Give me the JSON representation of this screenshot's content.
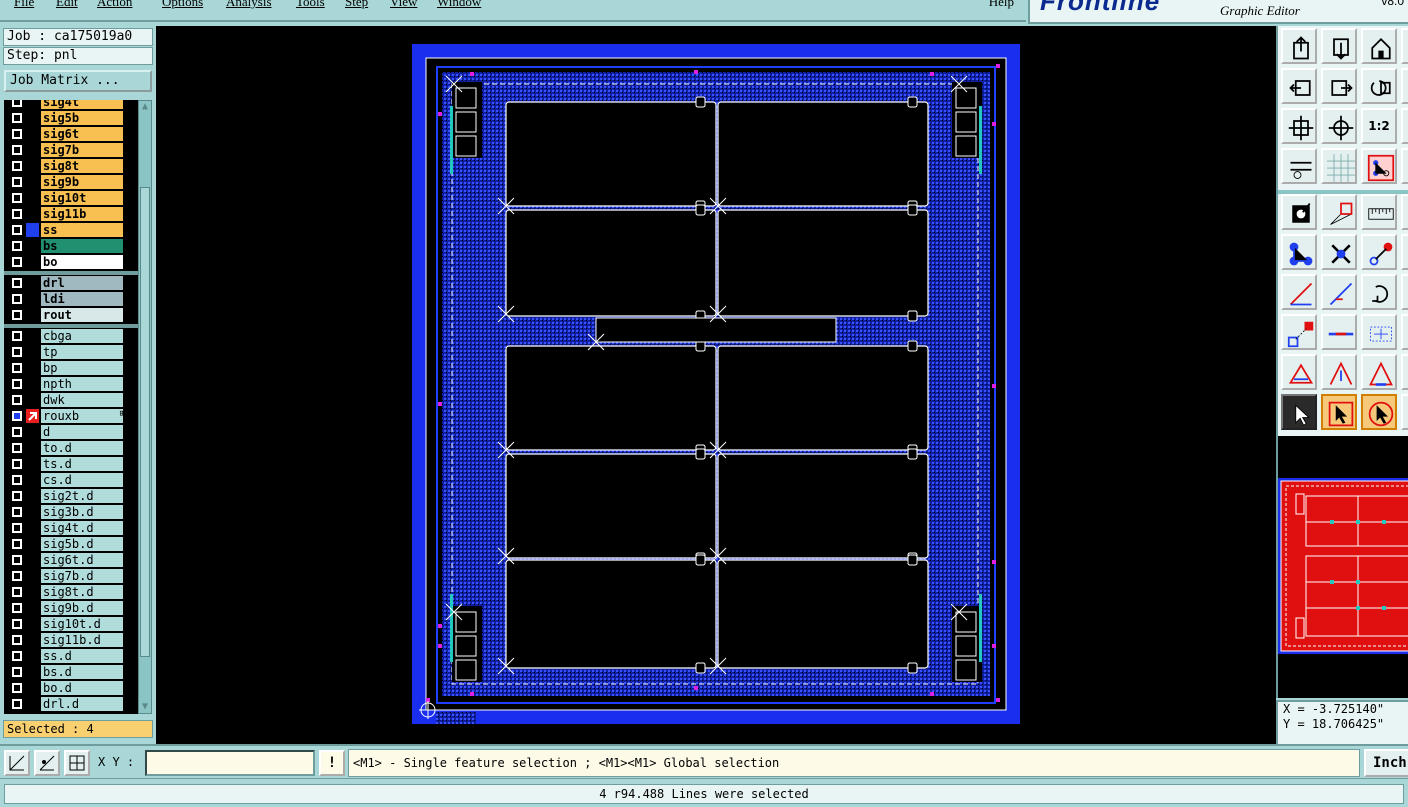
{
  "app": {
    "brand": "Frontline",
    "subtitle": "Graphic Editor",
    "version": "v8.0"
  },
  "menu": {
    "items": [
      "File",
      "Edit",
      "Action",
      "Options",
      "Analysis",
      "Tools",
      "Step",
      "View",
      "Window"
    ],
    "help": "Help"
  },
  "job": {
    "job_label": "Job : ca175019a0",
    "step_label": "Step: pnl"
  },
  "job_matrix_label": "Job Matrix ...",
  "layer_groups": [
    [
      {
        "name": "sig4t",
        "color": "#f8c050"
      },
      {
        "name": "sig5b",
        "color": "#f8c050"
      },
      {
        "name": "sig6t",
        "color": "#f8c050"
      },
      {
        "name": "sig7b",
        "color": "#f8c050"
      },
      {
        "name": "sig8t",
        "color": "#f8c050"
      },
      {
        "name": "sig9b",
        "color": "#f8c050"
      },
      {
        "name": "sig10t",
        "color": "#f8c050"
      },
      {
        "name": "sig11b",
        "color": "#f8c050"
      },
      {
        "name": "ss",
        "color": "#f8c050",
        "indicator": "#2040f0"
      },
      {
        "name": "bs",
        "color": "#209070"
      },
      {
        "name": "bo",
        "color": "#ffffff"
      }
    ],
    [
      {
        "name": "drl",
        "color": "#a0b8c0"
      },
      {
        "name": "ldi",
        "color": "#a0b8c0"
      },
      {
        "name": "rout",
        "color": "#d8e8e8"
      }
    ],
    [
      {
        "name": "cbga",
        "color": "#b0dcdc"
      },
      {
        "name": "tp",
        "color": "#b0dcdc"
      },
      {
        "name": "bp",
        "color": "#b0dcdc"
      },
      {
        "name": "npth",
        "color": "#b0dcdc"
      },
      {
        "name": "dwk",
        "color": "#b0dcdc"
      },
      {
        "name": "rouxb",
        "color": "#b0dcdc",
        "active": true,
        "plus": "⊞"
      },
      {
        "name": "d",
        "color": "#b0dcdc"
      },
      {
        "name": "to.d",
        "color": "#b0dcdc"
      },
      {
        "name": "ts.d",
        "color": "#b0dcdc"
      },
      {
        "name": "cs.d",
        "color": "#b0dcdc"
      },
      {
        "name": "sig2t.d",
        "color": "#b0dcdc"
      },
      {
        "name": "sig3b.d",
        "color": "#b0dcdc"
      },
      {
        "name": "sig4t.d",
        "color": "#b0dcdc"
      },
      {
        "name": "sig5b.d",
        "color": "#b0dcdc"
      },
      {
        "name": "sig6t.d",
        "color": "#b0dcdc"
      },
      {
        "name": "sig7b.d",
        "color": "#b0dcdc"
      },
      {
        "name": "sig8t.d",
        "color": "#b0dcdc"
      },
      {
        "name": "sig9b.d",
        "color": "#b0dcdc"
      },
      {
        "name": "sig10t.d",
        "color": "#b0dcdc"
      },
      {
        "name": "sig11b.d",
        "color": "#b0dcdc"
      },
      {
        "name": "ss.d",
        "color": "#b0dcdc"
      },
      {
        "name": "bs.d",
        "color": "#b0dcdc"
      },
      {
        "name": "bo.d",
        "color": "#b0dcdc"
      },
      {
        "name": "drl.d",
        "color": "#b0dcdc"
      }
    ]
  ],
  "selected_label": "Selected : 4",
  "tool_icons": [
    "open-job-icon",
    "save-job-icon",
    "home-icon",
    "zoom-back-icon",
    "zoom-forward-icon",
    "reset-zoom-icon",
    "zoom-fit-icon",
    "zoom-home-icon",
    "zoom-1-2-icon",
    "measure-settings-icon",
    "grid-icon",
    "layer-snap-icon",
    "feature-info-icon",
    "draw-shape-icon",
    "ruler-icon",
    "connect-icon",
    "delete-icon",
    "move-node-icon",
    "line-angle-icon",
    "line-arrow-icon",
    "rotate-icon",
    "pad-add-icon",
    "line-edit-icon",
    "snap-center-icon",
    "triangle-add-icon",
    "triangle-up-icon",
    "triangle-pointer-icon",
    "pointer-select-icon",
    "pointer-box-icon",
    "pointer-zoom-icon"
  ],
  "zoom_ratio_label": "1:2",
  "coords": {
    "x": "X = -3.725140\"",
    "y": "Y = 18.706425\""
  },
  "cmd": {
    "xy_label": "X Y :",
    "xy_value": "",
    "excl": "!",
    "hint": "<M1> - Single feature selection ; <M1><M1> Global selection",
    "unit": "Inch"
  },
  "status_message": "4 r94.488 Lines were selected",
  "colors": {
    "panel_bg": "#a9d7d7",
    "canvas_bg": "#000000",
    "board_blue": "#1a2ef0",
    "outline": "#ffffff",
    "overview_red": "#e01010",
    "accent_cyan": "#20c8c0",
    "marker_magenta": "#e020e0"
  }
}
